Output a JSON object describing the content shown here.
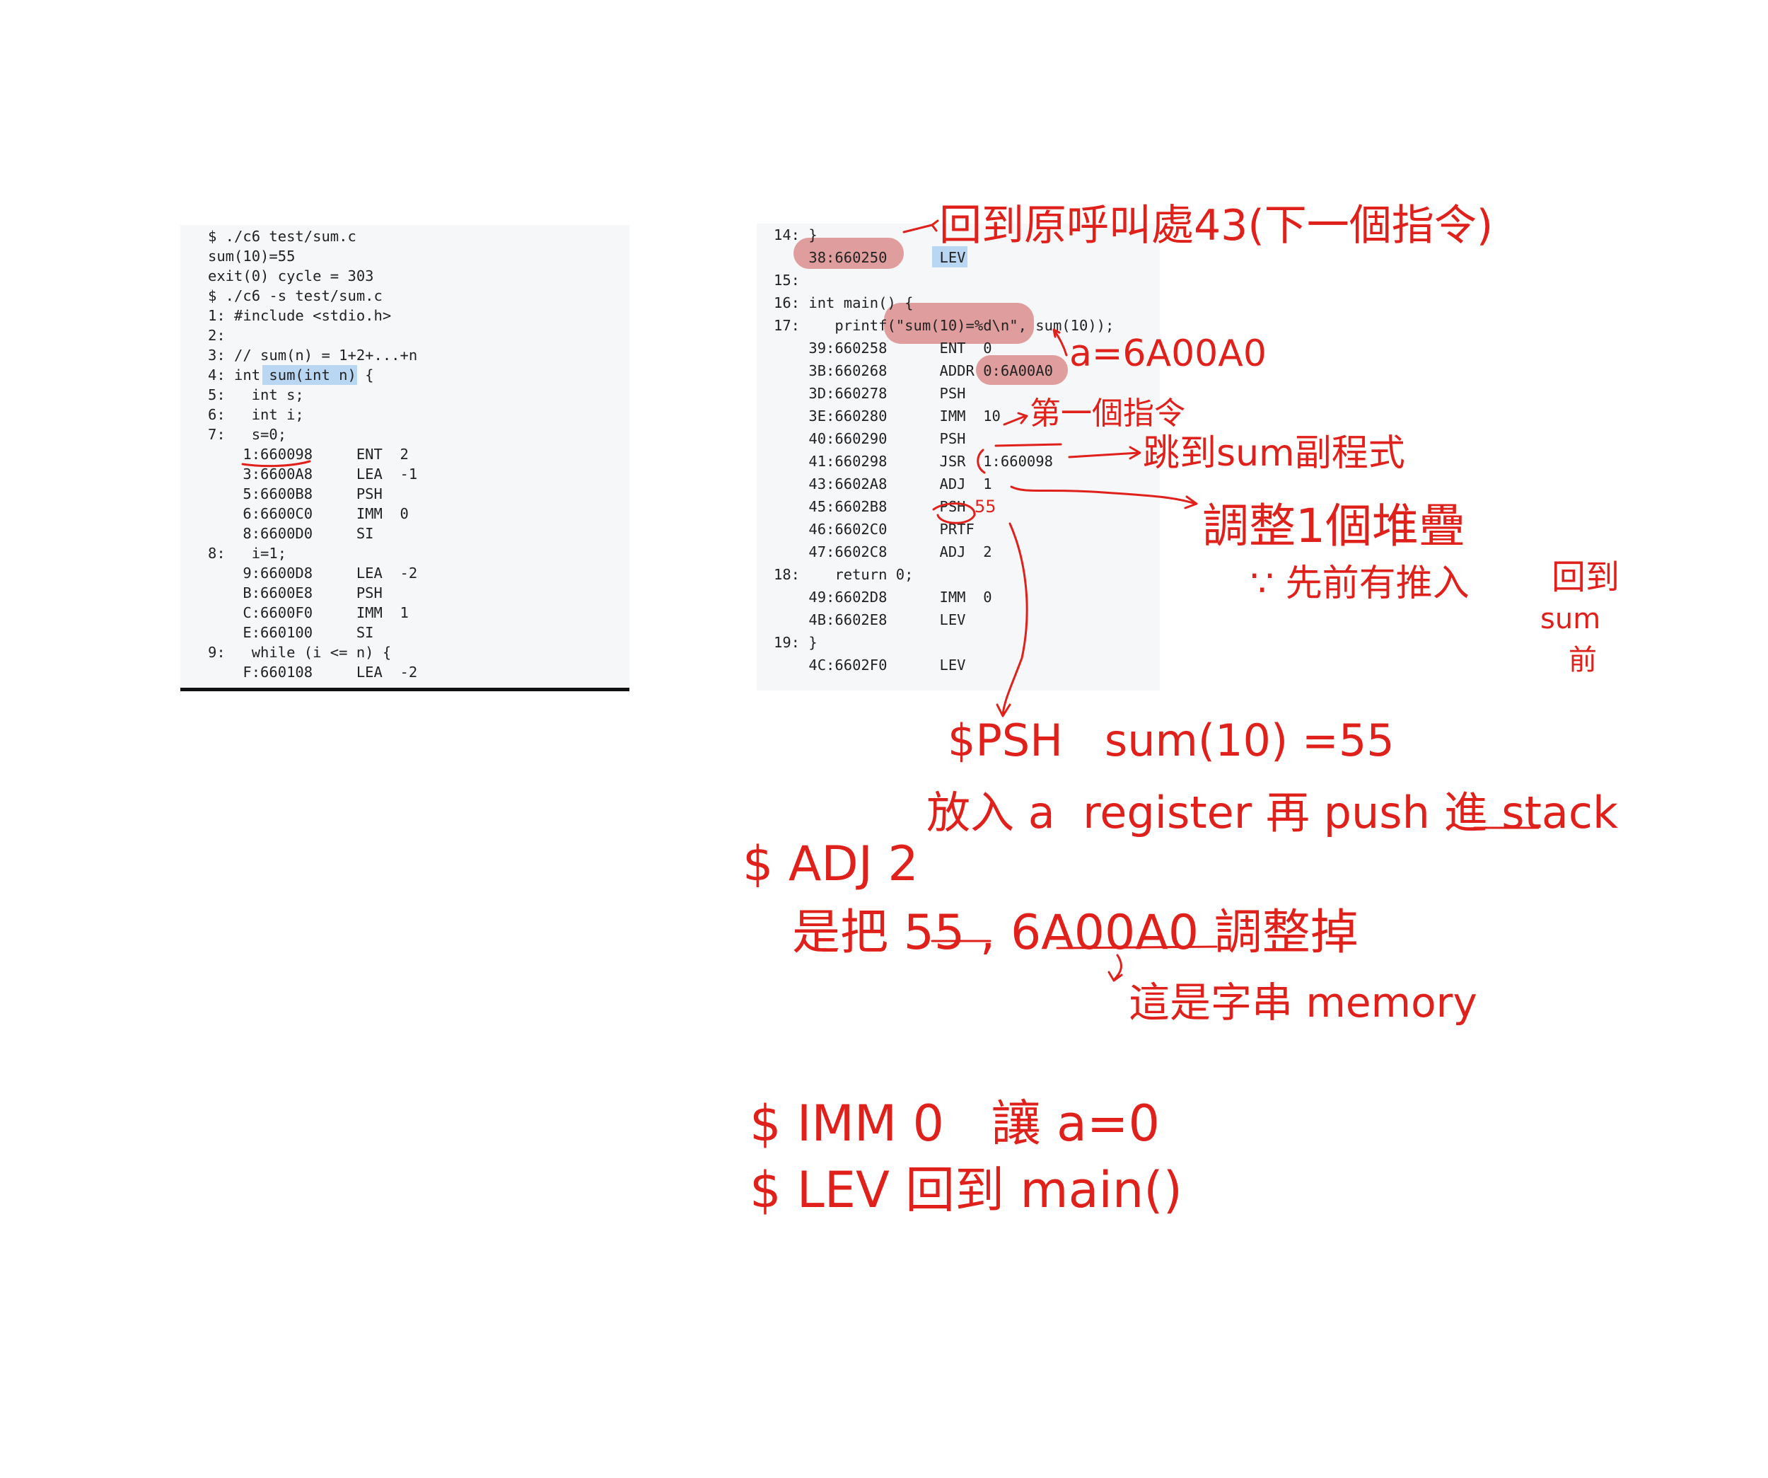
{
  "left_terminal": {
    "lines": [
      "$ ./c6 test/sum.c",
      "sum(10)=55",
      "exit(0) cycle = 303",
      "$ ./c6 -s test/sum.c",
      "1: #include <stdio.h>",
      "2:",
      "3: // sum(n) = 1+2+...+n",
      "4: int sum(int n) {",
      "5:   int s;",
      "6:   int i;",
      "7:   s=0;",
      "    1:660098     ENT  2",
      "    3:6600A8     LEA  -1",
      "    5:6600B8     PSH",
      "    6:6600C0     IMM  0",
      "    8:6600D0     SI",
      "8:   i=1;",
      "    9:6600D8     LEA  -2",
      "    B:6600E8     PSH",
      "    C:6600F0     IMM  1",
      "    E:660100     SI",
      "9:   while (i <= n) {",
      "    F:660108     LEA  -2"
    ]
  },
  "right_terminal": {
    "lines": [
      "14: }",
      "    38:660250      LEV",
      "15:",
      "16: int main() {",
      "17:    printf(\"sum(10)=%d\\n\", sum(10));",
      "    39:660258      ENT  0",
      "    3B:660268      ADDR 0:6A00A0",
      "    3D:660278      PSH",
      "    3E:660280      IMM  10",
      "    40:660290      PSH",
      "    41:660298      JSR  1:660098",
      "    43:6602A8      ADJ  1",
      "    45:6602B8      PSH",
      "    46:6602C0      PRTF",
      "    47:6602C8      ADJ  2",
      "18:    return 0;",
      "    49:6602D8      IMM  0",
      "    4B:6602E8      LEV",
      "19: }",
      "    4C:6602F0      LEV"
    ]
  },
  "handwriting": {
    "return_note": "回到原呼叫處43(下一個指令)",
    "a_value": "a=6A00A0",
    "first_instr": "第一個指令",
    "jump_note": "跳到sum副程式",
    "psh_small": "55",
    "adjust_note": "調整1個堆疊",
    "because_note": "∵ 先前有推入",
    "back_to": "回到",
    "sum_word": "sum",
    "before_word": "前",
    "psh_line1": "$PSH   sum(10) =55",
    "psh_line2": "放入 a  register 再 push 進 stack",
    "adj_line1": "$ ADJ 2",
    "adj_line2": "是把 55 , 6A00A0 調整掉",
    "adj_line3": "這是字串 memory",
    "imm_line": "$ IMM 0   讓 a=0",
    "lev_line": "$ LEV 回到 main()"
  },
  "colors": {
    "ink": "#e0201b",
    "highlight_blue": "#b9d6f2",
    "highlight_red": "#d77f7f",
    "panel_bg": "#f6f7f8"
  }
}
